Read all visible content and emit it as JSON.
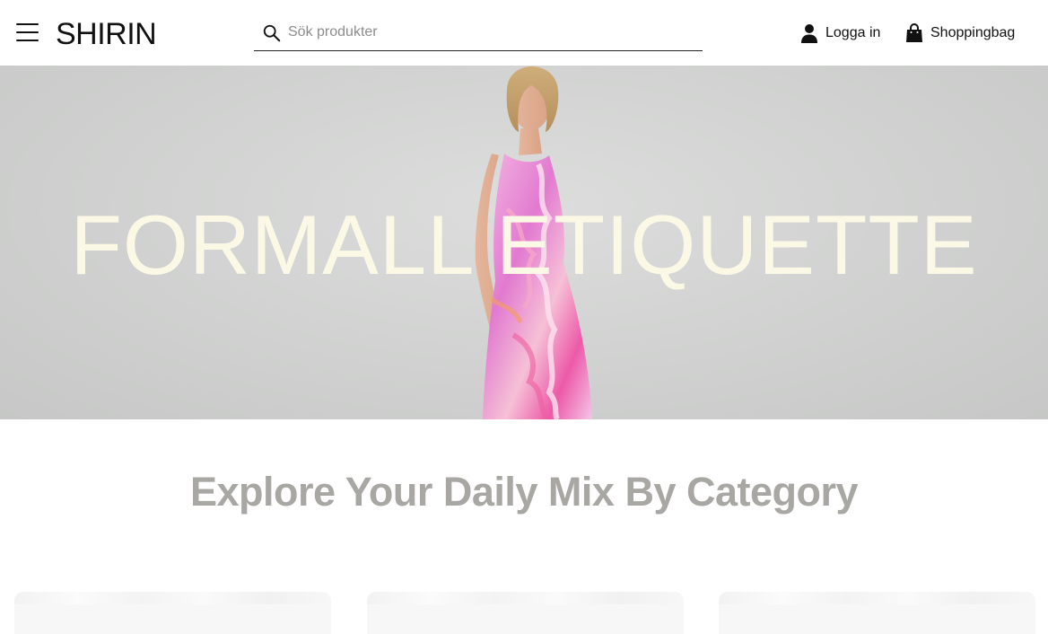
{
  "header": {
    "menu_icon": "hamburger-menu-icon",
    "logo": "SHIRIN",
    "search": {
      "placeholder": "Sök produkter",
      "value": "",
      "icon": "search-icon"
    },
    "login": {
      "label": "Logga in",
      "icon": "user-icon"
    },
    "bag": {
      "label": "Shoppingbag",
      "icon": "shopping-bag-icon"
    }
  },
  "hero": {
    "title": "FORMALL ETIQUETTE",
    "title_color": "#fbf9e6"
  },
  "categories": {
    "title": "Explore Your Daily Mix By Category",
    "title_color": "#a8a7a3",
    "cards": [
      {},
      {},
      {}
    ]
  }
}
